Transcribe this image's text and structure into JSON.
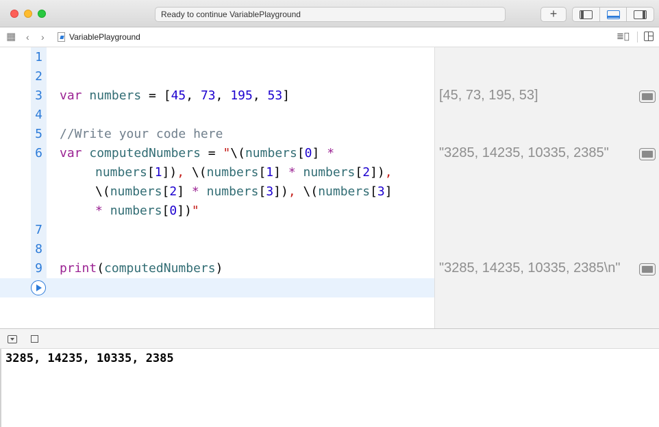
{
  "window": {
    "activity_status": "Ready to continue VariablePlayground",
    "add_button_label": "+"
  },
  "jumpbar": {
    "file_name": "VariablePlayground",
    "grid_icon": "▦",
    "back_icon": "‹",
    "forward_icon": "›",
    "right_icon": "≣⃞"
  },
  "editor": {
    "line_numbers": [
      "1",
      "2",
      "3",
      "4",
      "5",
      "6",
      "7",
      "8",
      "9"
    ],
    "lines": {
      "l3": {
        "kw": "var",
        "name": "numbers",
        "eq": " = [",
        "n1": "45",
        "c1": ", ",
        "n2": "73",
        "c2": ", ",
        "n3": "195",
        "c3": ", ",
        "n4": "53",
        "end": "]"
      },
      "l5": {
        "comment": "//Write your code here"
      },
      "l6a": {
        "kw": "var",
        "name": "computedNumbers",
        "eq": " = ",
        "q": "\"",
        "esc": "\\(",
        "id": "numbers",
        "ob": "[",
        "n": "0",
        "cb": "]",
        "op": " *"
      },
      "l6b": {
        "id1": "numbers",
        "ob1": "[",
        "n1": "1",
        "cb1": "])",
        "comma1": ",",
        "esc1": " \\(",
        "id2": "numbers",
        "ob2": "[",
        "n2": "1",
        "cb2": "]",
        "op": " *",
        "sp": " ",
        "id3": "numbers",
        "ob3": "[",
        "n3": "2",
        "cb3": "])",
        "comma2": ","
      },
      "l6c": {
        "esc1": "\\(",
        "id1": "numbers",
        "ob1": "[",
        "n1": "2",
        "cb1": "]",
        "op": " *",
        "sp": " ",
        "id2": "numbers",
        "ob2": "[",
        "n2": "3",
        "cb2": "])",
        "comma": ",",
        "esc2": " \\(",
        "id3": "numbers",
        "ob3": "[",
        "n3": "3",
        "cb3": "]"
      },
      "l6d": {
        "op": "*",
        "sp": " ",
        "id": "numbers",
        "ob": "[",
        "n": "0",
        "cb": "])",
        "q": "\""
      },
      "l9": {
        "fn": "print",
        "op": "(",
        "arg": "computedNumbers",
        "cp": ")"
      }
    }
  },
  "results": {
    "r3": "[45, 73, 195, 53]",
    "r6": "\"3285, 14235, 10335, 2385\"",
    "r9": "\"3285, 14235, 10335, 2385\\n\""
  },
  "console": {
    "output": "3285, 14235, 10335, 2385"
  },
  "colors": {
    "keyword": "#9b2393",
    "identifier": "#326d74",
    "number": "#1c00cf",
    "string": "#c41a16",
    "comment": "#707f8c",
    "accent": "#2c7bd9"
  }
}
